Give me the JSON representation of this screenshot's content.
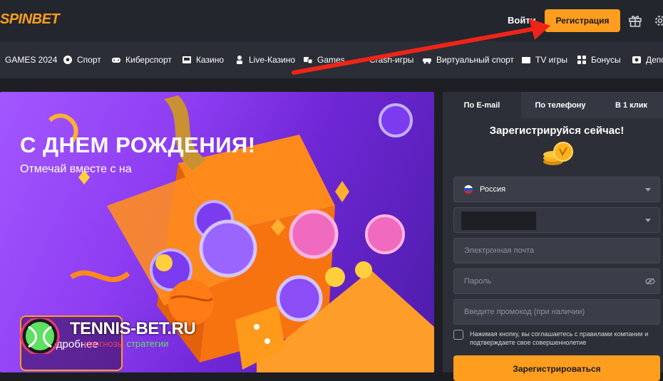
{
  "header": {
    "logo_text": "SPINBET",
    "login_label": "Войти",
    "register_label": "Регистрация",
    "icons": [
      "gift-icon",
      "gear-icon"
    ],
    "brand_color": "#ff9d1e"
  },
  "nav": {
    "items": [
      {
        "label": "GAMES 2024",
        "icon": ""
      },
      {
        "label": "Спорт",
        "icon": "soccer-ball-icon"
      },
      {
        "label": "Киберспорт",
        "icon": "gamepad-icon"
      },
      {
        "label": "Казино",
        "icon": "slot-machine-icon"
      },
      {
        "label": "Live-Казино",
        "icon": "dealer-icon"
      },
      {
        "label": "Games",
        "icon": "dice-icon"
      },
      {
        "label": "Crash-игры",
        "icon": "rocket-icon"
      },
      {
        "label": "Виртуальный спорт",
        "icon": "car-icon"
      },
      {
        "label": "TV игры",
        "icon": "tv-icon"
      },
      {
        "label": "Бонусы",
        "icon": "bonus-icon"
      },
      {
        "label": "Депо",
        "icon": "deposit-icon"
      }
    ]
  },
  "banner": {
    "title": "С ДНЕМ РОЖДЕНИЯ!",
    "subtitle": "Отмечай вместе с на",
    "more_label": "Подробнее"
  },
  "watermark": {
    "text": "TENNIS-BET.RU",
    "sub_a": "прогнозы",
    "sub_b": "стратегии"
  },
  "registration": {
    "tabs": [
      "По E-mail",
      "По телефону",
      "В 1 клик"
    ],
    "active_tab": 0,
    "title": "Зарегистрируйся сейчас!",
    "country_value": "Россия",
    "email_placeholder": "Электронная почта",
    "password_placeholder": "Пароль",
    "promo_placeholder": "Введите промокод (при наличии)",
    "terms_text": "Нажимая кнопку, вы соглашаетесь с правилами компании и подтверждаете свое совершеннолетие",
    "submit_label": "Зарегистрироваться"
  },
  "colors": {
    "accent": "#ff9d1e",
    "arrow": "#ef2418",
    "banner_purple": "#8e3df2"
  }
}
